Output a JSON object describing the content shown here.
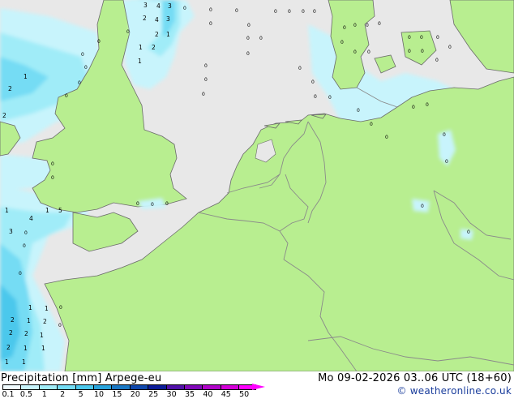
{
  "footer": {
    "title": "Precipitation [mm] Arpege-eu",
    "valid_time": "Mo 09-02-2026 03..06 UTC (18+60)",
    "credit": "© weatheronline.co.uk"
  },
  "legend": {
    "levels": [
      "0.1",
      "0.5",
      "1",
      "2",
      "5",
      "10",
      "15",
      "20",
      "25",
      "30",
      "35",
      "40",
      "45",
      "50"
    ],
    "colors": [
      "#f0fcff",
      "#c8f4fc",
      "#a0ecf8",
      "#74dcf4",
      "#4cc8ec",
      "#2aa4dc",
      "#1a78c4",
      "#1048ac",
      "#0c1c98",
      "#5010a8",
      "#8008b8",
      "#b004c8",
      "#d400d8",
      "#ff00ff"
    ]
  },
  "colors": {
    "sea": "#e8e8e8",
    "land": "#b8ee90",
    "border": "#8a8a8a",
    "coast": "#6a6a6a"
  },
  "rain_labels": [
    {
      "t": "3",
      "area": "north-sea-north"
    },
    {
      "t": "4",
      "area": "north-sea-north"
    },
    {
      "t": "3",
      "area": "north-sea-north"
    },
    {
      "t": "2",
      "area": "north-sea-north"
    },
    {
      "t": "4",
      "area": "north-sea-north"
    },
    {
      "t": "3",
      "area": "north-sea-north"
    },
    {
      "t": "2",
      "area": "north-sea-north"
    },
    {
      "t": "1",
      "area": "north-sea-north"
    },
    {
      "t": "1",
      "area": "north-sea-north"
    },
    {
      "t": "2",
      "area": "irish-sea"
    },
    {
      "t": "1",
      "area": "irish-sea"
    },
    {
      "t": "1",
      "area": "irish-sea"
    },
    {
      "t": "2",
      "area": "celtic-sea"
    },
    {
      "t": "2",
      "area": "celtic-sea"
    },
    {
      "t": "1",
      "area": "celtic-sea"
    },
    {
      "t": "1",
      "area": "celtic-sea"
    },
    {
      "t": "5",
      "area": "biscay"
    },
    {
      "t": "4",
      "area": "biscay"
    },
    {
      "t": "3",
      "area": "biscay"
    },
    {
      "t": "2",
      "area": "biscay"
    },
    {
      "t": "1",
      "area": "biscay"
    },
    {
      "t": "2",
      "area": "biscay"
    },
    {
      "t": "1",
      "area": "biscay"
    },
    {
      "t": "1",
      "area": "biscay"
    }
  ]
}
